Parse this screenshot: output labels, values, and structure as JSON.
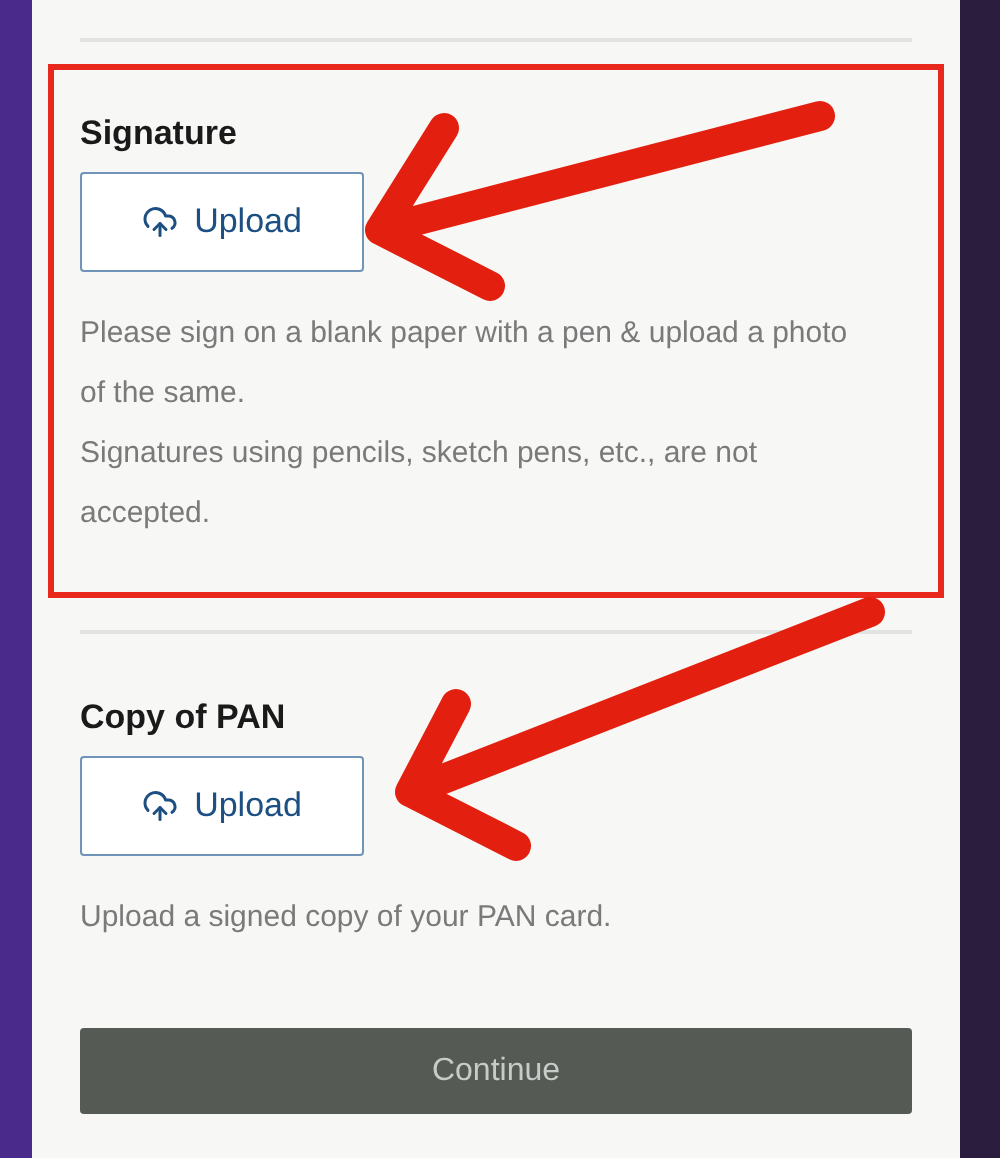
{
  "sections": [
    {
      "title": "Signature",
      "button": "Upload",
      "highlighted": true,
      "help": [
        "Please sign on a blank paper with a pen & upload a photo of the same.",
        "Signatures using pencils, sketch pens, etc., are not accepted."
      ]
    },
    {
      "title": "Copy of PAN",
      "button": "Upload",
      "highlighted": false,
      "help": [
        "Upload a signed copy of your PAN card."
      ]
    }
  ],
  "continue_button": {
    "label": "Continue",
    "disabled": true
  },
  "annotations": [
    {
      "kind": "arrow"
    },
    {
      "kind": "arrow"
    }
  ]
}
